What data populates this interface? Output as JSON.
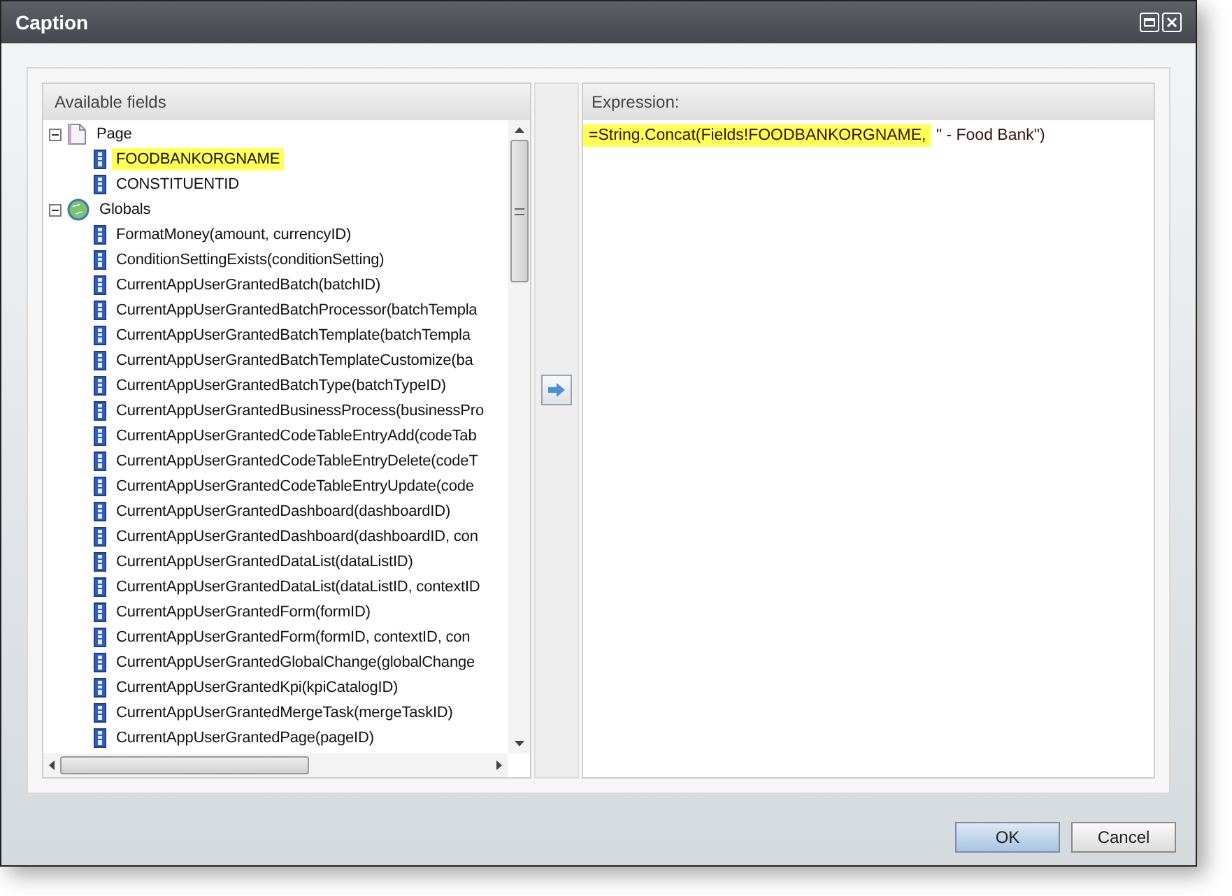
{
  "window": {
    "title": "Caption"
  },
  "fields_panel": {
    "title": "Available fields",
    "tree": [
      {
        "label": "Page",
        "kind": "page",
        "expanded": true,
        "selected": false,
        "children": [
          {
            "label": "FOODBANKORGNAME",
            "kind": "field",
            "selected": true
          },
          {
            "label": "CONSTITUENTID",
            "kind": "field",
            "selected": false
          }
        ]
      },
      {
        "label": "Globals",
        "kind": "globe",
        "expanded": true,
        "selected": false,
        "children": [
          {
            "label": "FormatMoney(amount, currencyID)",
            "kind": "field",
            "selected": false
          },
          {
            "label": "ConditionSettingExists(conditionSetting)",
            "kind": "field",
            "selected": false
          },
          {
            "label": "CurrentAppUserGrantedBatch(batchID)",
            "kind": "field",
            "selected": false
          },
          {
            "label": "CurrentAppUserGrantedBatchProcessor(batchTempla",
            "kind": "field",
            "selected": false
          },
          {
            "label": "CurrentAppUserGrantedBatchTemplate(batchTempla",
            "kind": "field",
            "selected": false
          },
          {
            "label": "CurrentAppUserGrantedBatchTemplateCustomize(ba",
            "kind": "field",
            "selected": false
          },
          {
            "label": "CurrentAppUserGrantedBatchType(batchTypeID)",
            "kind": "field",
            "selected": false
          },
          {
            "label": "CurrentAppUserGrantedBusinessProcess(businessPro",
            "kind": "field",
            "selected": false
          },
          {
            "label": "CurrentAppUserGrantedCodeTableEntryAdd(codeTab",
            "kind": "field",
            "selected": false
          },
          {
            "label": "CurrentAppUserGrantedCodeTableEntryDelete(codeT",
            "kind": "field",
            "selected": false
          },
          {
            "label": "CurrentAppUserGrantedCodeTableEntryUpdate(code",
            "kind": "field",
            "selected": false
          },
          {
            "label": "CurrentAppUserGrantedDashboard(dashboardID)",
            "kind": "field",
            "selected": false
          },
          {
            "label": "CurrentAppUserGrantedDashboard(dashboardID, con",
            "kind": "field",
            "selected": false
          },
          {
            "label": "CurrentAppUserGrantedDataList(dataListID)",
            "kind": "field",
            "selected": false
          },
          {
            "label": "CurrentAppUserGrantedDataList(dataListID, contextID",
            "kind": "field",
            "selected": false
          },
          {
            "label": "CurrentAppUserGrantedForm(formID)",
            "kind": "field",
            "selected": false
          },
          {
            "label": "CurrentAppUserGrantedForm(formID, contextID, con",
            "kind": "field",
            "selected": false
          },
          {
            "label": "CurrentAppUserGrantedGlobalChange(globalChange",
            "kind": "field",
            "selected": false
          },
          {
            "label": "CurrentAppUserGrantedKpi(kpiCatalogID)",
            "kind": "field",
            "selected": false
          },
          {
            "label": "CurrentAppUserGrantedMergeTask(mergeTaskID)",
            "kind": "field",
            "selected": false
          },
          {
            "label": "CurrentAppUserGrantedPage(pageID)",
            "kind": "field",
            "selected": false
          }
        ]
      }
    ]
  },
  "expression_panel": {
    "title": "Expression:",
    "highlighted": "=String.Concat(Fields!FOODBANKORGNAME,",
    "rest": " \" - Food Bank\")"
  },
  "buttons": [
    {
      "label": "OK",
      "kind": "default"
    },
    {
      "label": "Cancel",
      "kind": "normal"
    }
  ]
}
